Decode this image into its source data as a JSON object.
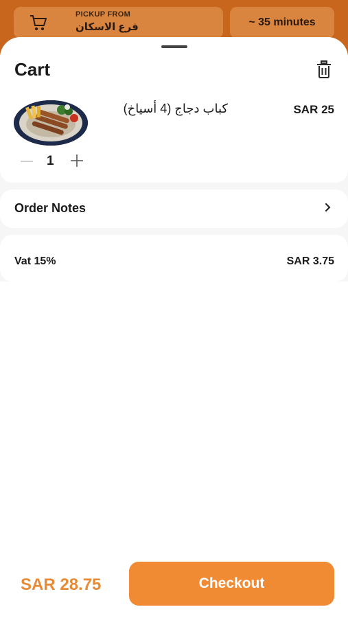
{
  "header": {
    "pickup_label": "PICKUP FROM",
    "branch": "فرع الاسكان",
    "eta": "~ 35 minutes",
    "icons": {
      "cart": "cart-icon"
    }
  },
  "cart": {
    "title": "Cart",
    "icons": {
      "delete": "trash-icon",
      "increase": "plus-icon",
      "decrease": "minus-icon"
    },
    "items": [
      {
        "name": "كباب دجاج (4 أسياخ)",
        "price": "SAR 25",
        "quantity": "1"
      }
    ]
  },
  "order_notes": {
    "label": "Order Notes",
    "icon": "chevron-right-icon"
  },
  "summary": {
    "vat_label": "Vat 15%",
    "vat_value": "SAR 3.75"
  },
  "footer": {
    "total": "SAR 28.75",
    "checkout_label": "Checkout"
  },
  "colors": {
    "accent": "#f08a33",
    "total_text": "#e98a35",
    "header_bg": "#c8661d"
  }
}
